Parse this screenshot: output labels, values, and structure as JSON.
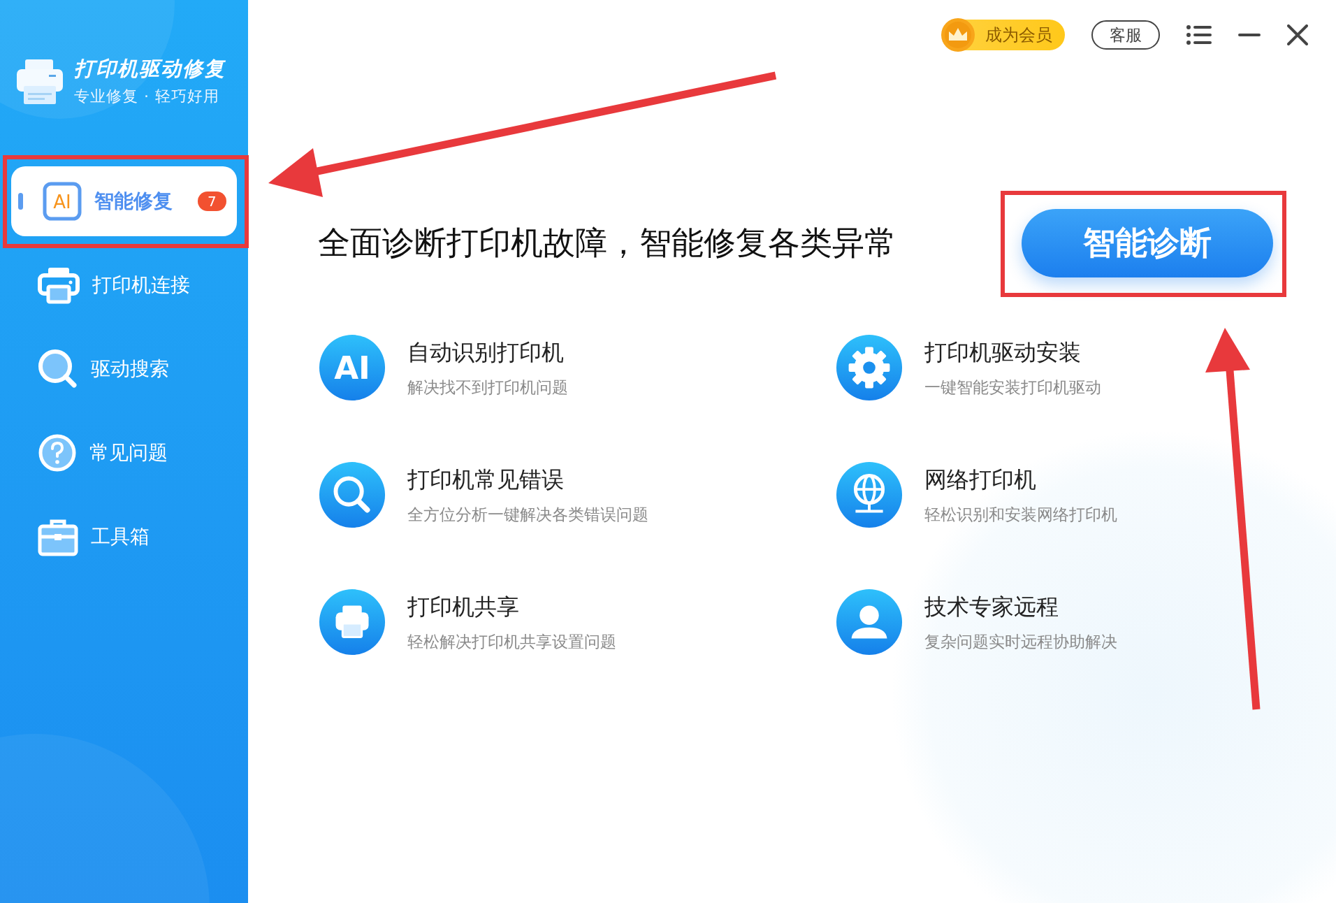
{
  "app": {
    "title": "打印机驱动修复",
    "subtitle": "专业修复 · 轻巧好用"
  },
  "nav": [
    {
      "kind": "ai",
      "label": "智能修复",
      "selected": true,
      "badge": "7",
      "icon_text": "AI"
    },
    {
      "kind": "printer",
      "label": "打印机连接",
      "selected": false
    },
    {
      "kind": "search",
      "label": "驱动搜索",
      "selected": false
    },
    {
      "kind": "help",
      "label": "常见问题",
      "selected": false
    },
    {
      "kind": "toolbox",
      "label": "工具箱",
      "selected": false
    }
  ],
  "topbar": {
    "vip_button": "成为会员",
    "service_button": "客服"
  },
  "headline": "全面诊断打印机故障，智能修复各类异常",
  "diagnose_button": "智能诊断",
  "features": [
    {
      "kind": "ai",
      "icon_text": "AI",
      "title": "自动识别打印机",
      "description": "解决找不到打印机问题"
    },
    {
      "kind": "gear",
      "title": "打印机驱动安装",
      "description": "一键智能安装打印机驱动"
    },
    {
      "kind": "search",
      "title": "打印机常见错误",
      "description": "全方位分析一键解决各类错误问题"
    },
    {
      "kind": "globe",
      "title": "网络打印机",
      "description": "轻松识别和安装网络打印机"
    },
    {
      "kind": "printer",
      "title": "打印机共享",
      "description": "轻松解决打印机共享设置问题"
    },
    {
      "kind": "person",
      "title": "技术专家远程",
      "description": "复杂问题实时远程协助解决"
    }
  ]
}
